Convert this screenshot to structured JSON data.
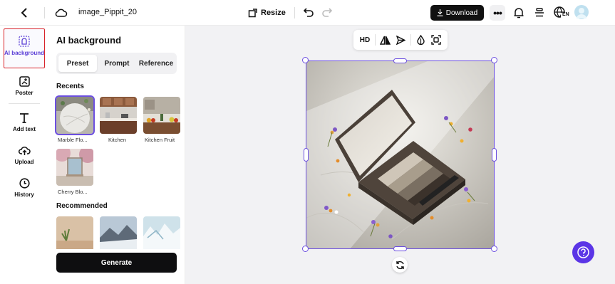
{
  "topbar": {
    "back_icon": "chevron-left-icon",
    "cloud_icon": "cloud-icon",
    "project_title": "image_Pippit_20",
    "resize_label": "Resize",
    "download_label": "Download",
    "more_label": "•••",
    "lang_badge": "EN"
  },
  "rail": {
    "items": [
      {
        "label": "AI background",
        "icon": "ai-background-icon",
        "active": true
      },
      {
        "label": "Poster",
        "icon": "poster-icon"
      },
      {
        "label": "Add text",
        "icon": "text-icon"
      },
      {
        "label": "Upload",
        "icon": "upload-cloud-icon"
      },
      {
        "label": "History",
        "icon": "clock-icon"
      }
    ]
  },
  "panel": {
    "title": "AI background",
    "tabs": [
      {
        "label": "Preset",
        "selected": true
      },
      {
        "label": "Prompt"
      },
      {
        "label": "Reference"
      }
    ],
    "recents_heading": "Recents",
    "recents": [
      {
        "label": "Marble Flo...",
        "selected": true
      },
      {
        "label": "Kitchen"
      },
      {
        "label": "Kitchen Fruit"
      },
      {
        "label": "Cherry Blo..."
      }
    ],
    "recommended_heading": "Recommended",
    "generate_label": "Generate"
  },
  "canvas_toolbar": {
    "hd_label": "HD",
    "flip_icon": "flip-icon",
    "send_icon": "send-icon",
    "drop_icon": "opacity-drop-icon",
    "frame_icon": "smart-crop-icon"
  },
  "colors": {
    "accent": "#6c4fe0",
    "help_button": "#5b35e6",
    "highlight_border": "#d8232a"
  }
}
